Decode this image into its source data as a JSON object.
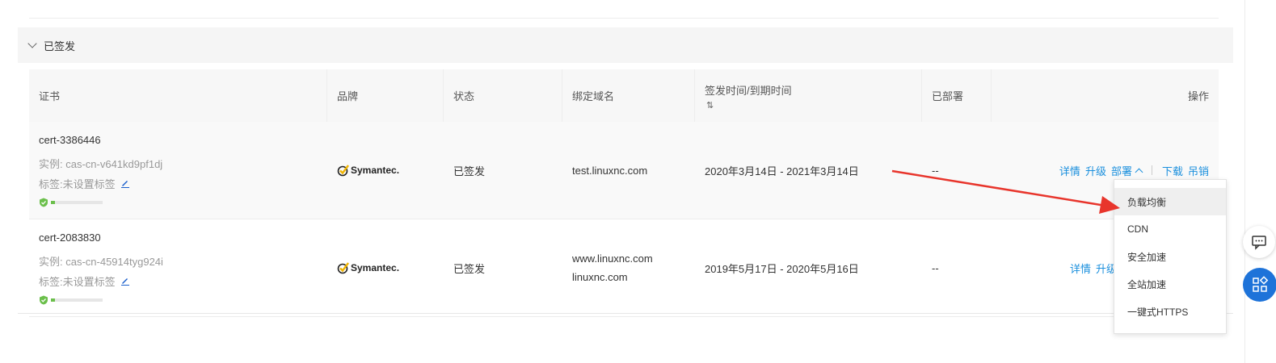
{
  "section": {
    "title": "已签发"
  },
  "table": {
    "headers": {
      "cert": "证书",
      "brand": "品牌",
      "status": "状态",
      "domain": "绑定域名",
      "time": "签发时间/到期时间",
      "sort_icon": "⇅",
      "deployed": "已部署",
      "ops": "操作"
    },
    "rows": [
      {
        "cert_id": "cert-3386446",
        "instance": "实例: cas-cn-v641kd9pf1dj",
        "tag": "标签:未设置标签",
        "brand": "Symantec.",
        "status": "已签发",
        "domains": [
          "test.linuxnc.com"
        ],
        "time": "2020年3月14日 - 2021年3月14日",
        "deployed": "--",
        "ops": {
          "detail": "详情",
          "upgrade": "升级",
          "deploy": "部署",
          "download": "下载",
          "revoke": "吊销"
        }
      },
      {
        "cert_id": "cert-2083830",
        "instance": "实例: cas-cn-45914tyg924i",
        "tag": "标签:未设置标签",
        "brand": "Symantec.",
        "status": "已签发",
        "domains": [
          "www.linuxnc.com",
          "linuxnc.com"
        ],
        "time": "2019年5月17日 - 2020年5月16日",
        "deployed": "--",
        "ops": {
          "detail": "详情",
          "upgrade": "升级"
        }
      }
    ]
  },
  "deploy_menu": {
    "items": [
      "负载均衡",
      "CDN",
      "安全加速",
      "全站加速",
      "一键式HTTPS"
    ],
    "active_index": 0
  },
  "colors": {
    "link": "#1a8fdd",
    "shield": "#6bbf4b",
    "arrow": "#e8352c",
    "float_blue": "#1e73d9"
  },
  "icons": {
    "expand": "chevron-down-icon",
    "edit": "pencil-icon",
    "security": "shield-icon",
    "brand": "symantec-check-icon",
    "collapse": "chevron-up-icon",
    "chat": "chat-icon",
    "apps": "apps-icon"
  }
}
